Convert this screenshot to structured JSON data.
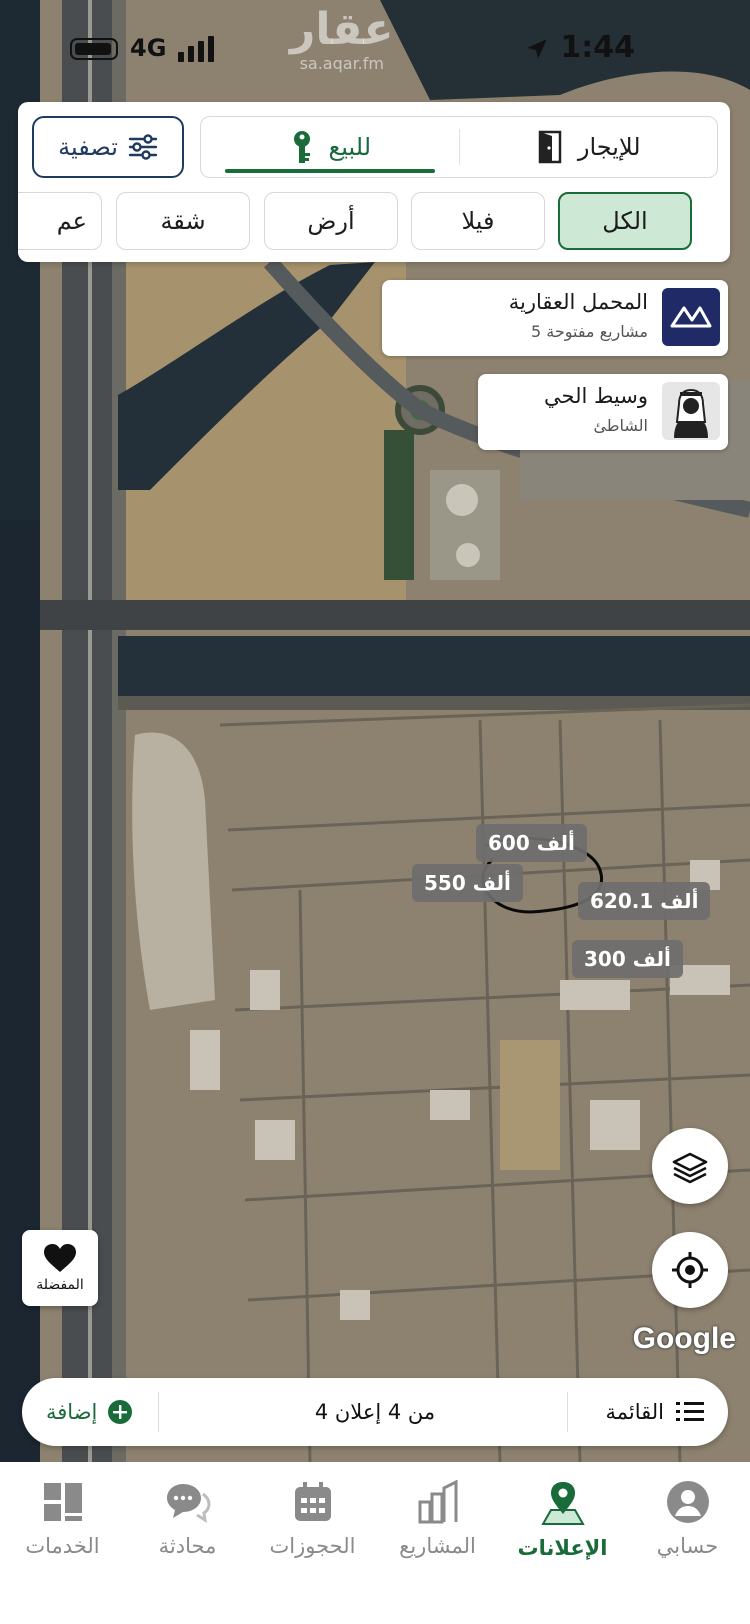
{
  "status_bar": {
    "network": "4G",
    "time": "1:44"
  },
  "watermark": {
    "logo": "عقار",
    "url": "sa.aqar.fm"
  },
  "filter": {
    "filter_label": "تصفية",
    "segments": [
      {
        "label": "للإيجار",
        "icon": "door-icon",
        "active": false
      },
      {
        "label": "للبيع",
        "icon": "key-icon",
        "active": true
      }
    ],
    "chips": [
      "الكل",
      "فيلا",
      "أرض",
      "شقة",
      "عم"
    ],
    "active_chip": "الكل"
  },
  "project_card": {
    "title": "المحمل العقارية",
    "subtitle": "5 مشاريع مفتوحة"
  },
  "agent_card": {
    "title": "وسيط الحي",
    "subtitle": "الشاطئ"
  },
  "price_markers": [
    "600 ألف",
    "550 ألف",
    "620.1 ألف",
    "300 ألف"
  ],
  "map": {
    "favorite_label": "المفضلة",
    "attribution": "Google"
  },
  "action_bar": {
    "list_label": "القائمة",
    "count_label": "4 من 4 إعلان",
    "add_label": "إضافة"
  },
  "tabs": [
    {
      "label": "حسابي",
      "icon": "profile-icon",
      "active": false
    },
    {
      "label": "الإعلانات",
      "icon": "map-pin-icon",
      "active": true
    },
    {
      "label": "المشاريع",
      "icon": "buildings-icon",
      "active": false
    },
    {
      "label": "الحجوزات",
      "icon": "calendar-icon",
      "active": false
    },
    {
      "label": "محادثة",
      "icon": "chat-icon",
      "active": false
    },
    {
      "label": "الخدمات",
      "icon": "grid-icon",
      "active": false
    }
  ],
  "colors": {
    "accent": "#1a6b3a",
    "filter_border": "#1f3a5f",
    "chip_active_bg": "#cde8d4"
  }
}
